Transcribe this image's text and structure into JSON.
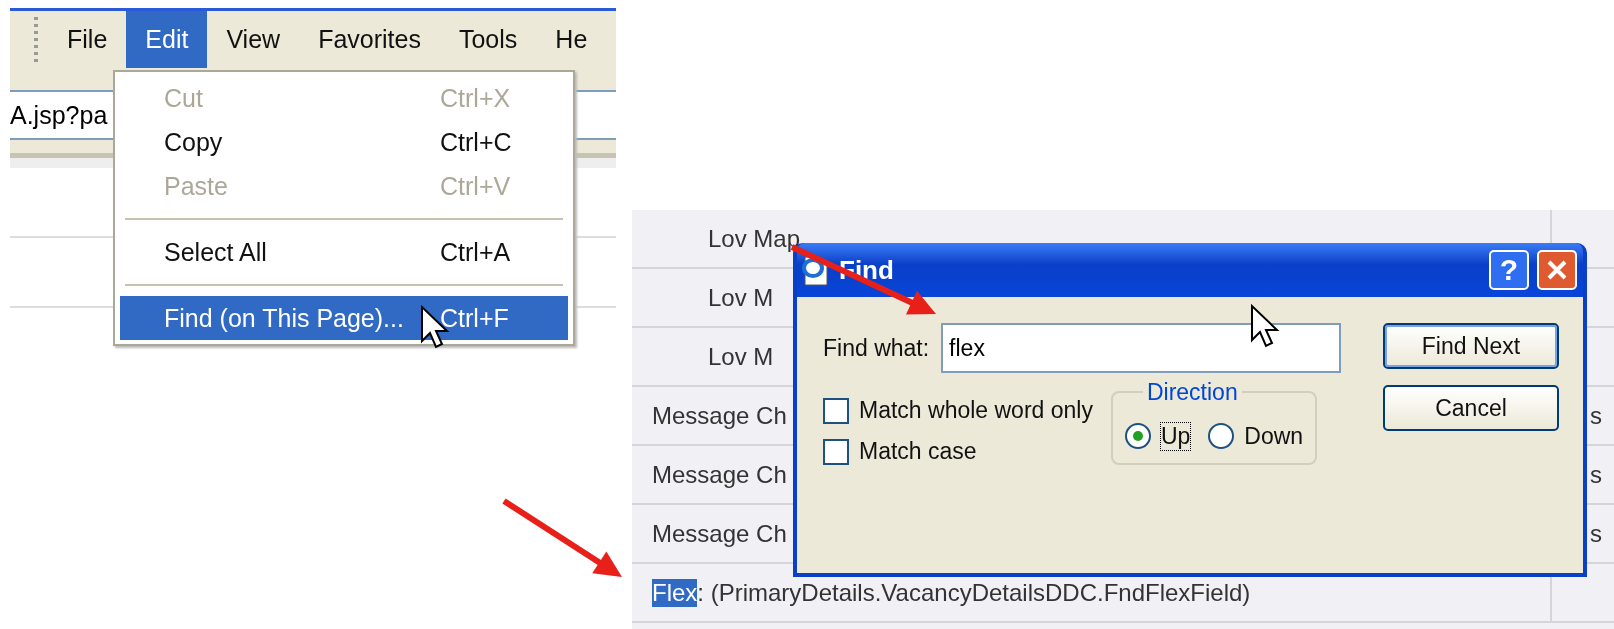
{
  "menubar": {
    "items": [
      {
        "label": "File",
        "selected": false
      },
      {
        "label": "Edit",
        "selected": true
      },
      {
        "label": "View",
        "selected": false
      },
      {
        "label": "Favorites",
        "selected": false
      },
      {
        "label": "Tools",
        "selected": false
      },
      {
        "label": "He",
        "selected": false
      }
    ]
  },
  "address": {
    "value": "A.jsp?pa"
  },
  "edit_menu": {
    "items": [
      {
        "kind": "item",
        "label": "Cut",
        "shortcut": "Ctrl+X",
        "disabled": true,
        "selected": false
      },
      {
        "kind": "item",
        "label": "Copy",
        "shortcut": "Ctrl+C",
        "disabled": false,
        "selected": false
      },
      {
        "kind": "item",
        "label": "Paste",
        "shortcut": "Ctrl+V",
        "disabled": true,
        "selected": false
      },
      {
        "kind": "separator"
      },
      {
        "kind": "item",
        "label": "Select All",
        "shortcut": "Ctrl+A",
        "disabled": false,
        "selected": false
      },
      {
        "kind": "separator"
      },
      {
        "kind": "item",
        "label": "Find (on This Page)...",
        "shortcut": "Ctrl+F",
        "disabled": false,
        "selected": true
      }
    ]
  },
  "page_rows": [
    {
      "kind": "child",
      "text": "Lov Map"
    },
    {
      "kind": "child",
      "text": "Lov M"
    },
    {
      "kind": "child",
      "text": "Lov M"
    },
    {
      "kind": "top",
      "text": "Message Ch",
      "column_2": "s"
    },
    {
      "kind": "top",
      "text": "Message Ch",
      "column_2": "s"
    },
    {
      "kind": "top",
      "text": "Message Ch",
      "column_2": "s"
    },
    {
      "kind": "match",
      "highlight": "Flex",
      "text": ": (PrimaryDetails.VacancyDetailsDDC.FndFlexField)"
    }
  ],
  "find_dialog": {
    "title": "Find",
    "help_button": "?",
    "find_what_label": "Find what:",
    "find_what_value": "flex",
    "options": [
      {
        "label": "Match whole word only",
        "checked": false
      },
      {
        "label": "Match case",
        "checked": false
      }
    ],
    "direction": {
      "label": "Direction",
      "options": [
        {
          "label": "Up",
          "selected": true
        },
        {
          "label": "Down",
          "selected": false
        }
      ]
    },
    "buttons": [
      "Find Next",
      "Cancel"
    ]
  }
}
